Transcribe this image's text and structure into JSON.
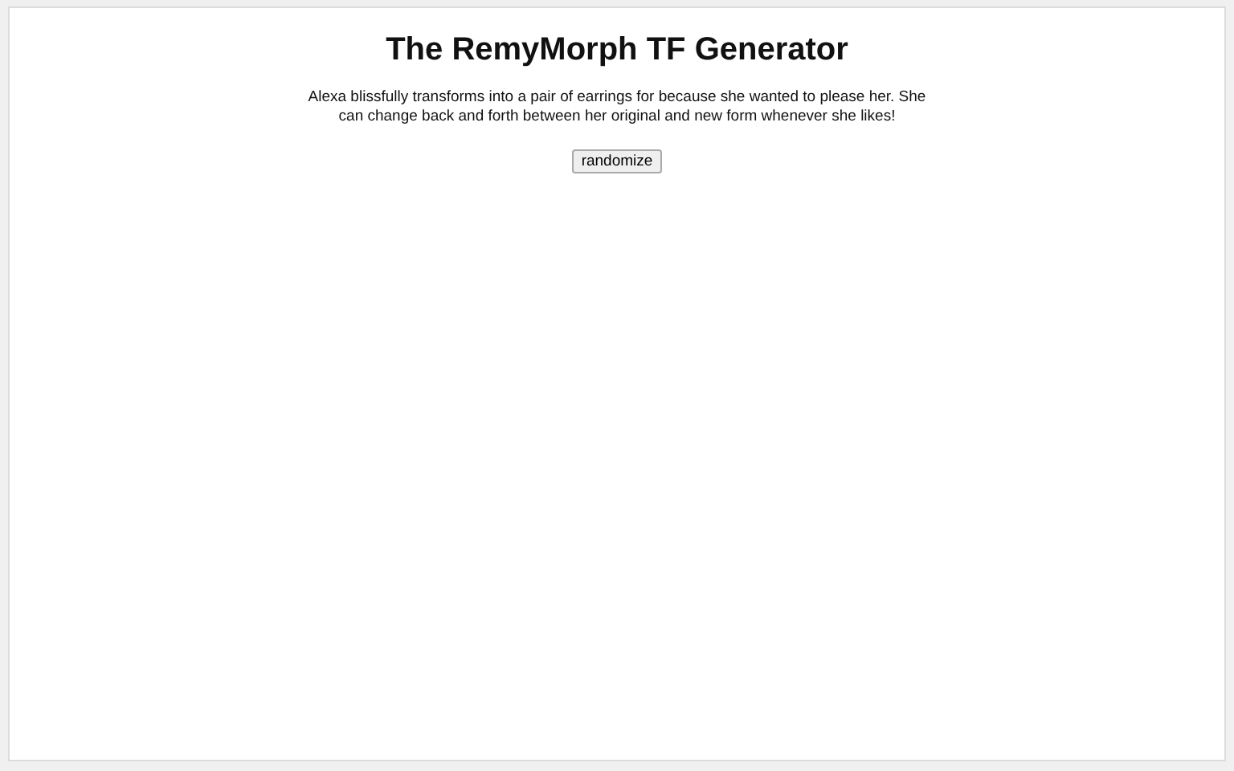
{
  "title": "The RemyMorph TF Generator",
  "description": "Alexa blissfully transforms into a pair of earrings for because she wanted to please her. She can change back and forth between her original and new form whenever she likes!",
  "buttons": [
    "randomize"
  ]
}
